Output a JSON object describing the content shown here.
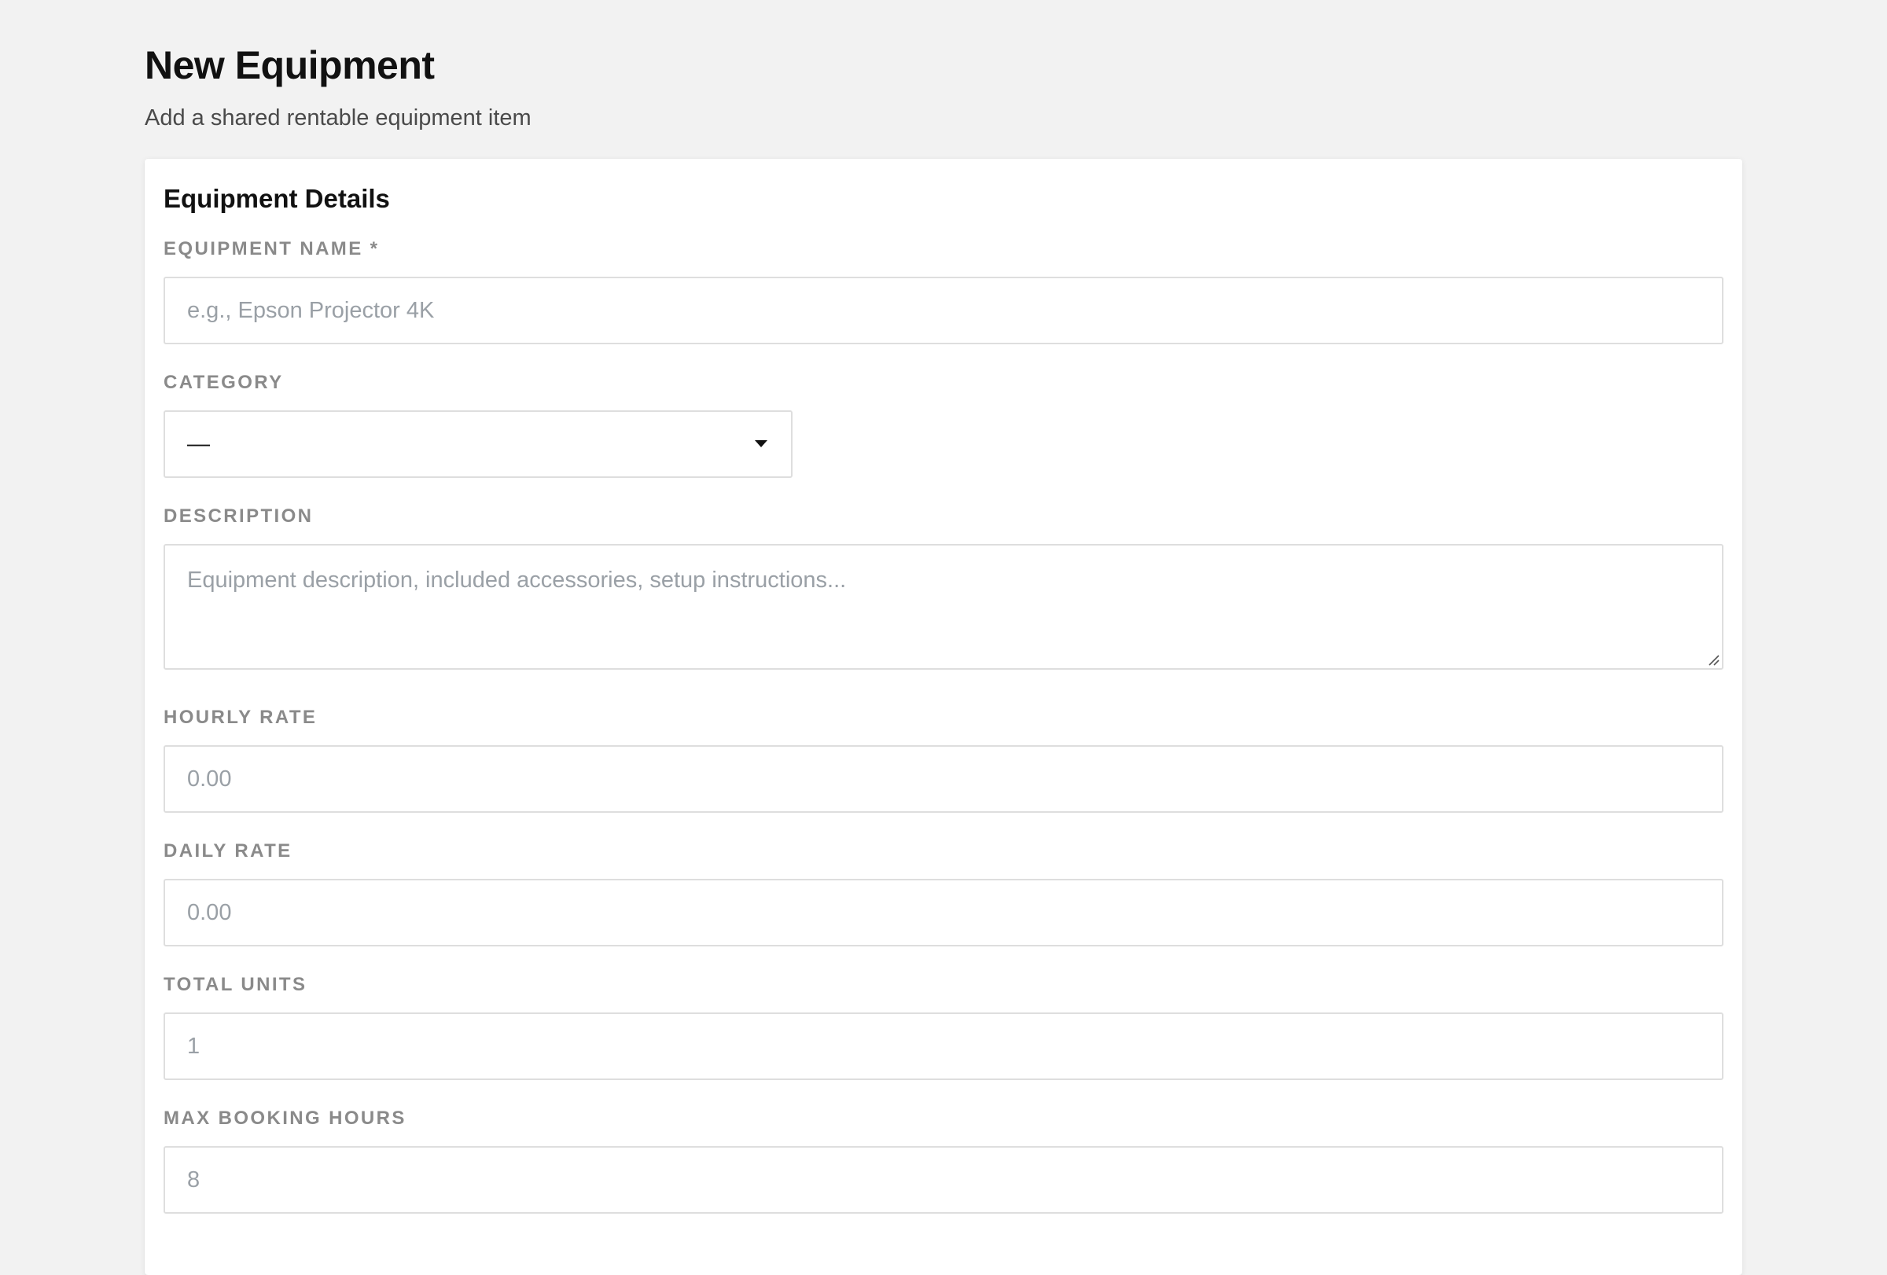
{
  "header": {
    "title": "New Equipment",
    "subtitle": "Add a shared rentable equipment item"
  },
  "card": {
    "title": "Equipment Details"
  },
  "form": {
    "name": {
      "label": "EQUIPMENT NAME *",
      "value": "",
      "placeholder": "e.g., Epson Projector 4K"
    },
    "category": {
      "label": "CATEGORY",
      "selected": "—"
    },
    "description": {
      "label": "DESCRIPTION",
      "value": "",
      "placeholder": "Equipment description, included accessories, setup instructions..."
    },
    "hourly_rate": {
      "label": "HOURLY RATE",
      "value": "",
      "placeholder": "0.00"
    },
    "daily_rate": {
      "label": "DAILY RATE",
      "value": "",
      "placeholder": "0.00"
    },
    "total_units": {
      "label": "TOTAL UNITS",
      "value": "",
      "placeholder": "1"
    },
    "max_booking_hours": {
      "label": "MAX BOOKING HOURS",
      "value": "",
      "placeholder": "8"
    }
  },
  "icons": {
    "category_dropdown": "chevron-down-icon",
    "description_resize": "resize-grip-icon"
  },
  "colors": {
    "page_background": "#f2f2f2",
    "card_background": "#ffffff",
    "label": "#8a8a8a",
    "placeholder": "#9aa0a6",
    "border": "#dedede"
  }
}
